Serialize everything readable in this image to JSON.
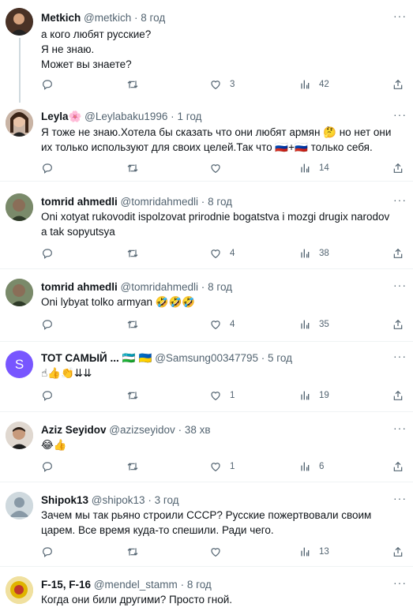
{
  "tweets": [
    {
      "name": "Metkich",
      "badge": "",
      "handle": "@metkich",
      "time": "8 год",
      "text": [
        "а кого любят русские?",
        "Я не знаю.",
        "Может вы знаете?"
      ],
      "replies": "",
      "retweets": "",
      "likes": "3",
      "views": "42"
    },
    {
      "name": "Leyla",
      "badge": "🌸",
      "handle": "@Leylabaku1996",
      "time": "1 год",
      "text": [
        "Я тоже не знаю.Хотела бы сказать что они любят армян 🤔 но нет они",
        "их только используют для своих целей.Так что 🇷🇺+🇷🇺 только себя."
      ],
      "replies": "",
      "retweets": "",
      "likes": "",
      "views": "14"
    },
    {
      "name": "tomrid ahmedli",
      "badge": "",
      "handle": "@tomridahmedli",
      "time": "8 год",
      "text": [
        "Oni xotyat rukovodit ispolzovat prirodnie bogatstva i mozgi drugix narodov",
        "a tak sopyutsya"
      ],
      "replies": "",
      "retweets": "",
      "likes": "4",
      "views": "38"
    },
    {
      "name": "tomrid ahmedli",
      "badge": "",
      "handle": "@tomridahmedli",
      "time": "8 год",
      "text": [
        "Oni lybyat tolko armyan 🤣🤣🤣"
      ],
      "replies": "",
      "retweets": "",
      "likes": "4",
      "views": "35"
    },
    {
      "name": "ТОТ САМЫЙ ...",
      "badge": "🇺🇿 🇺🇦",
      "handle": "@Samsung00347795",
      "time": "5 год",
      "text": [
        "☝👍👏⇊⇊"
      ],
      "replies": "",
      "retweets": "",
      "likes": "1",
      "views": "19"
    },
    {
      "name": "Aziz Seyidov",
      "badge": "",
      "handle": "@azizseyidov",
      "time": "38 хв",
      "text": [
        "😂👍"
      ],
      "replies": "",
      "retweets": "",
      "likes": "1",
      "views": "6"
    },
    {
      "name": "Shipok13",
      "badge": "",
      "handle": "@shipok13",
      "time": "3 год",
      "text": [
        "Зачем мы так рьяно строили СССР? Русские пожертвовали своим",
        "царем. Все время куда-то спешили. Ради чего."
      ],
      "replies": "",
      "retweets": "",
      "likes": "",
      "views": "13"
    },
    {
      "name": "F-15, F-16",
      "badge": "",
      "handle": "@mendel_stamm",
      "time": "8 год",
      "text": [
        "Когда они били другими? Просто гной."
      ],
      "replies": "",
      "retweets": "",
      "likes": "",
      "views": ""
    }
  ],
  "avatar_initial_s": "S",
  "colors": {
    "text": "#0f1419",
    "muted": "#536471",
    "divider": "#eff3f4",
    "s_avatar": "#7856ff"
  }
}
